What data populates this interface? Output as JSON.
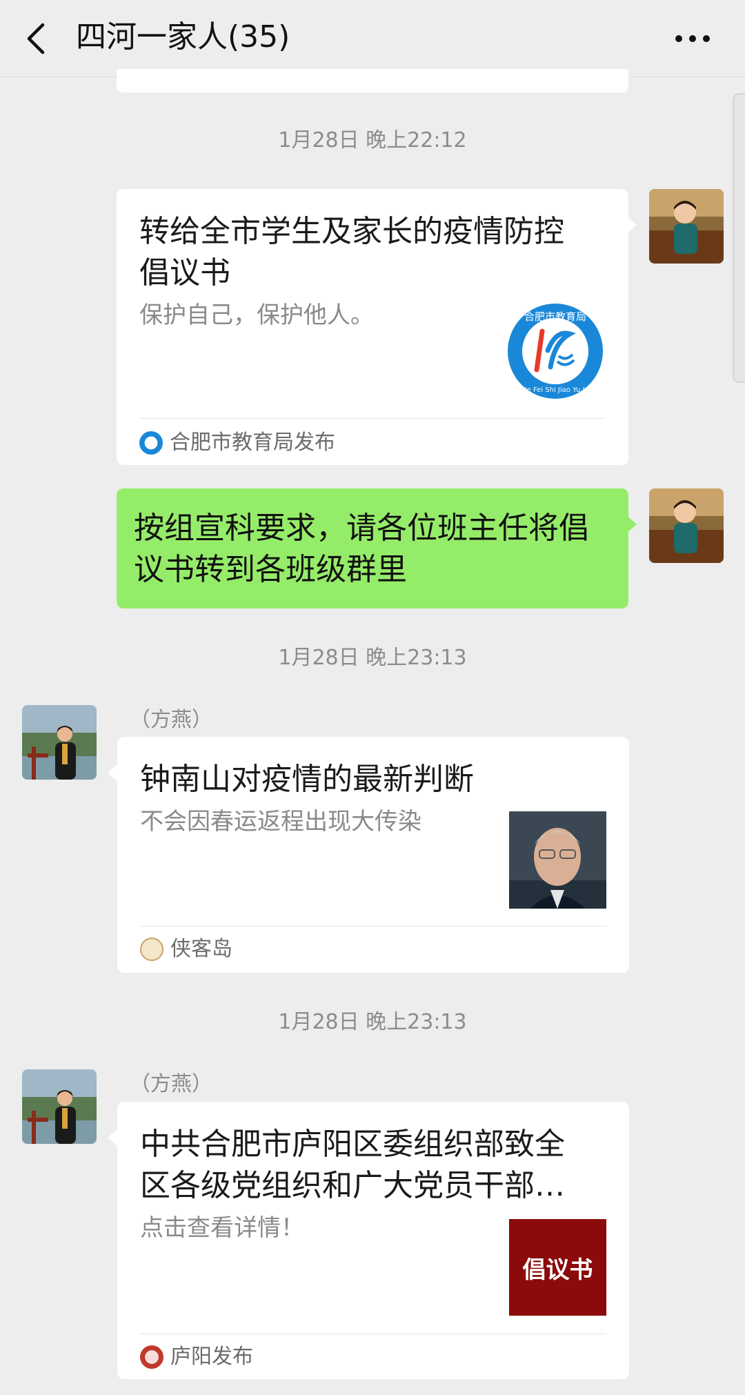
{
  "header": {
    "title": "四河一家人(35)"
  },
  "messages": [
    {
      "timestamp": "1月28日 晚上22:12",
      "type": "link-card",
      "title": "转给全市学生及家长的疫情防控倡议书",
      "title_lines": [
        "转给全市学生及家长的疫情防控",
        "倡议书"
      ],
      "description": "保护自己，保护他人。",
      "source": "合肥市教育局发布",
      "thumb": {
        "ring_text": "合肥市教育局",
        "ring_sub": "He Fei Shi Jiao Yu Ju",
        "color": "#1a88d8"
      }
    },
    {
      "type": "text",
      "text": "按组宣科要求，请各位班主任将倡议书转到各班级群里",
      "lines": [
        "按组宣科要求，请各位班主任将倡",
        "议书转到各班级群里"
      ]
    },
    {
      "timestamp": "1月28日 晚上23:13",
      "sender": "（方燕）",
      "type": "link-card",
      "title": "钟南山对疫情的最新判断",
      "description": "不会因春运返程出现大传染",
      "source": "侠客岛"
    },
    {
      "timestamp": "1月28日 晚上23:13",
      "sender": "（方燕）",
      "type": "link-card",
      "title": "中共合肥市庐阳区委组织部致全区各级党组织和广大党员干部…",
      "title_lines": [
        "中共合肥市庐阳区委组织部致全",
        "区各级党组织和广大党员干部…"
      ],
      "description": "点击查看详情！",
      "source": "庐阳发布",
      "thumb": {
        "text": "倡议书",
        "color": "#8b0a0a"
      }
    }
  ],
  "colors": {
    "background": "#ededed",
    "my_bubble": "#95ec69",
    "card": "#ffffff",
    "timestamp": "#8c8c8c"
  },
  "icons": [
    "back-arrow-icon",
    "more-icon"
  ]
}
